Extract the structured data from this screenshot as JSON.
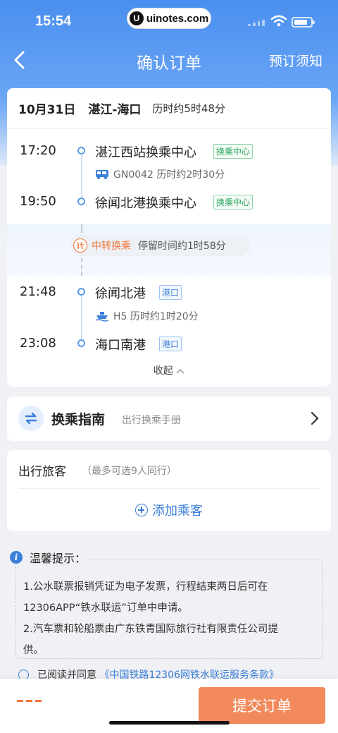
{
  "status_bar": {
    "time": "15:54",
    "watermark": "uinotes.com",
    "watermark_badge": "U"
  },
  "nav": {
    "title": "确认订单",
    "right_label": "预订须知"
  },
  "trip": {
    "date": "10月31日",
    "route": "湛江-海口",
    "duration": "历时约5时48分",
    "legs": [
      {
        "time": "17:20",
        "station": "湛江西站换乘中心",
        "tag": "换乘中心"
      },
      {
        "vehicle_icon": "bus-icon",
        "info": "GN0042 历时约2时30分"
      },
      {
        "time": "19:50",
        "station": "徐闻北港换乘中心",
        "tag": "换乘中心"
      },
      {
        "time": "21:48",
        "station": "徐闻北港",
        "tag": "港口"
      },
      {
        "vehicle_icon": "ship-icon",
        "info": "H5 历时约1时20分"
      },
      {
        "time": "23:08",
        "station": "海口南港",
        "tag": "港口"
      }
    ],
    "transfer": {
      "badge": "转",
      "label": "中转换乘",
      "note": "停留时间约1时58分"
    },
    "collapse_label": "收起"
  },
  "guide": {
    "title": "换乘指南",
    "subtitle": "出行换乘手册"
  },
  "passengers": {
    "title": "出行旅客",
    "hint": "（最多可选9人同行）",
    "add_label": "添加乘客"
  },
  "tips": {
    "title": "温馨提示：",
    "items": [
      "1.公水联票报销凭证为电子发票，行程结束两日后可在",
      "12306APP“铁水联运”订单中申请。",
      "2.汽车票和轮船票由广东铁青国际旅行社有限责任公司提",
      "供。"
    ]
  },
  "agreement": {
    "prefix": "已阅读并同意",
    "link": "《中国铁路12306网铁水联运服务条款》"
  },
  "bottom": {
    "submit_label": "提交订单"
  },
  "colors": {
    "brand_blue": "#4a8ff0",
    "accent_orange": "#f28a5c",
    "tag_green": "#27a55a"
  }
}
